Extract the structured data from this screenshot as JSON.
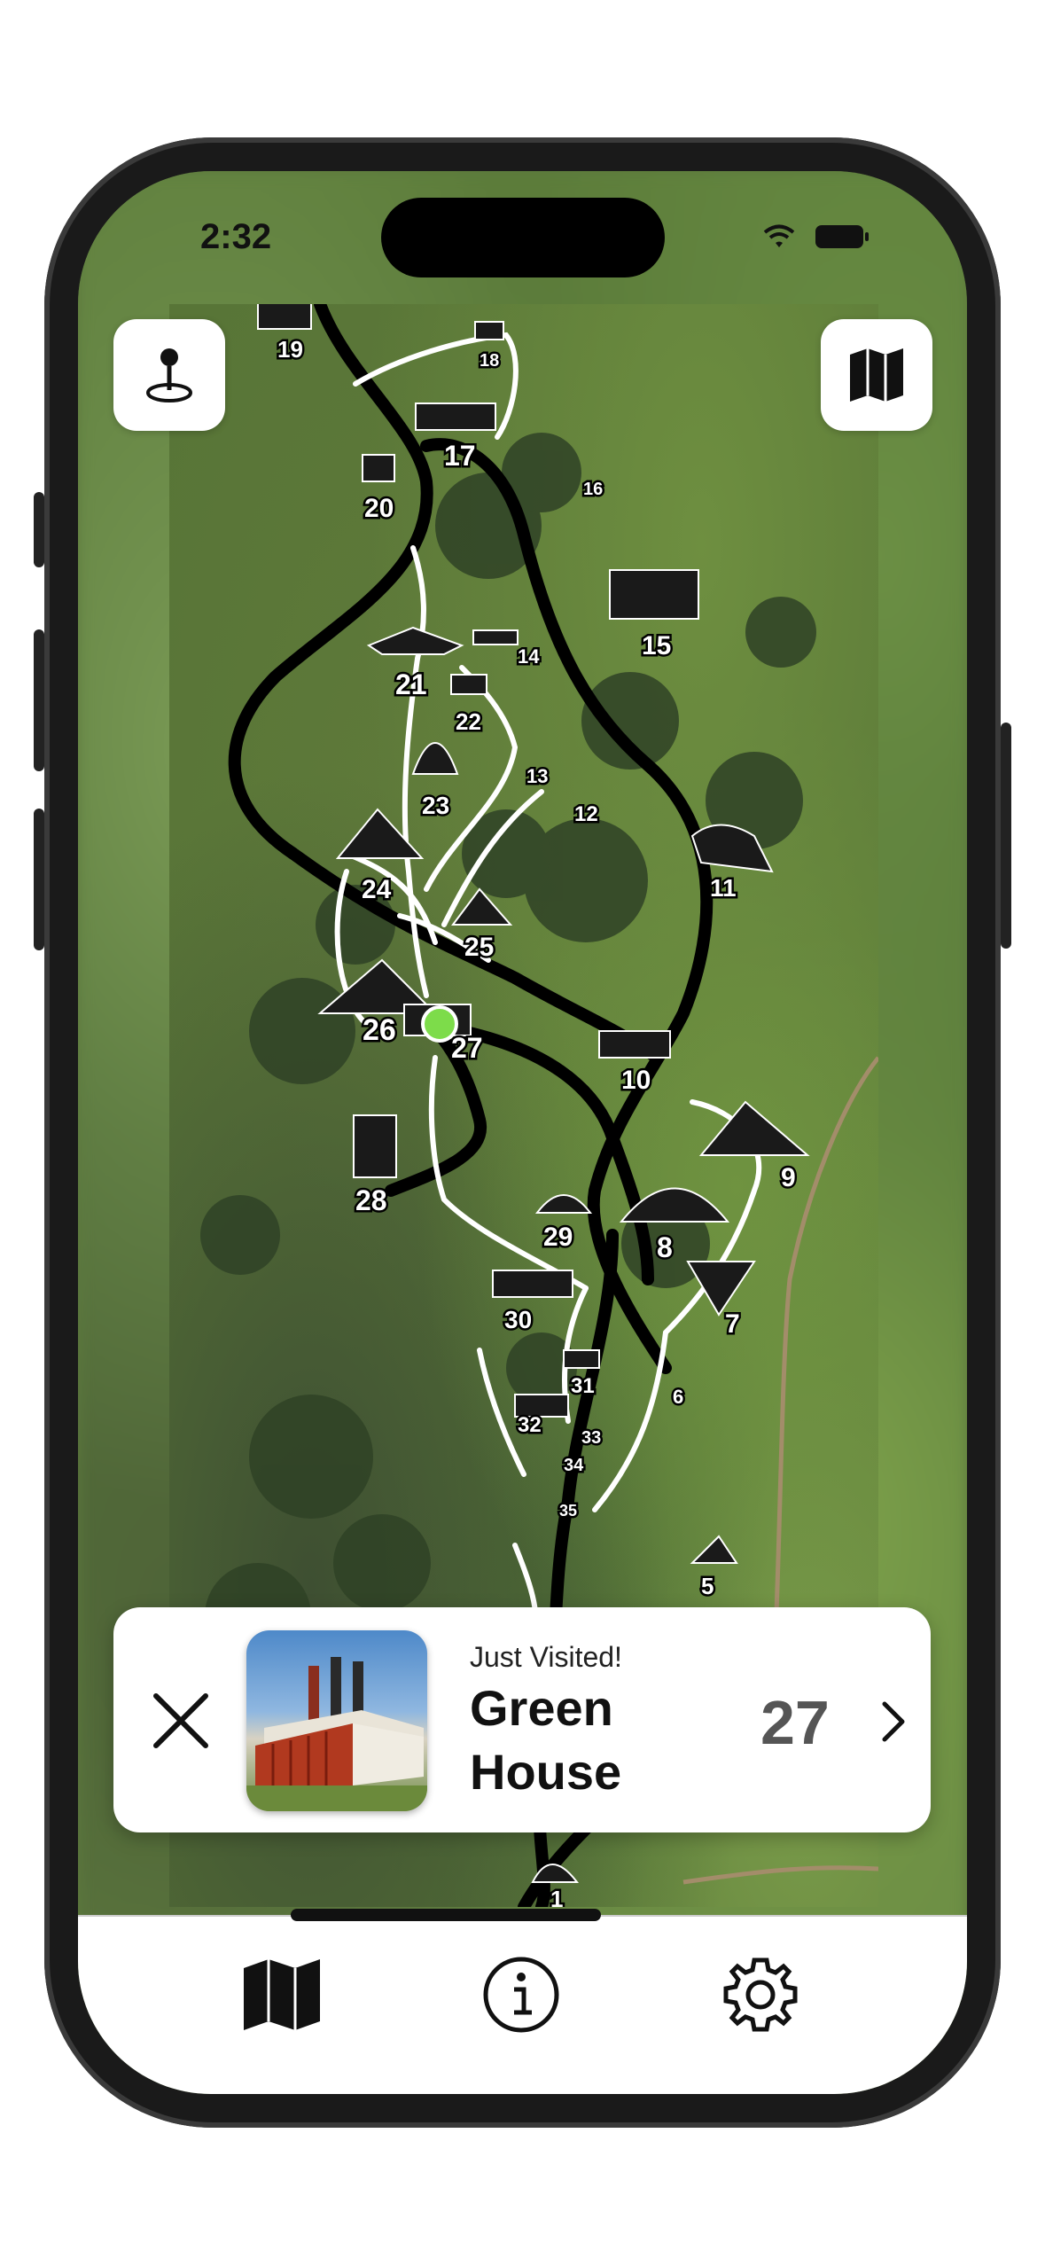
{
  "status_bar": {
    "time": "2:32"
  },
  "top_buttons": {
    "left_icon": "location-pin-icon",
    "right_icon": "map-icon"
  },
  "map": {
    "landmarks": [
      {
        "label": "19"
      },
      {
        "label": "18"
      },
      {
        "label": "17"
      },
      {
        "label": "16"
      },
      {
        "label": "20"
      },
      {
        "label": "15"
      },
      {
        "label": "14"
      },
      {
        "label": "21"
      },
      {
        "label": "22"
      },
      {
        "label": "13"
      },
      {
        "label": "12"
      },
      {
        "label": "23"
      },
      {
        "label": "24"
      },
      {
        "label": "11"
      },
      {
        "label": "25"
      },
      {
        "label": "26"
      },
      {
        "label": "27"
      },
      {
        "label": "10"
      },
      {
        "label": "9"
      },
      {
        "label": "28"
      },
      {
        "label": "29"
      },
      {
        "label": "8"
      },
      {
        "label": "30"
      },
      {
        "label": "7"
      },
      {
        "label": "31"
      },
      {
        "label": "6"
      },
      {
        "label": "32"
      },
      {
        "label": "33"
      },
      {
        "label": "34"
      },
      {
        "label": "35"
      },
      {
        "label": "5"
      },
      {
        "label": "1"
      }
    ],
    "current_location_color": "#7ddc4a"
  },
  "visited_card": {
    "subtitle": "Just Visited!",
    "title": "Green House",
    "number": "27"
  },
  "tab_bar": {
    "tabs": [
      {
        "icon": "map-icon"
      },
      {
        "icon": "info-icon"
      },
      {
        "icon": "gear-icon"
      }
    ]
  }
}
